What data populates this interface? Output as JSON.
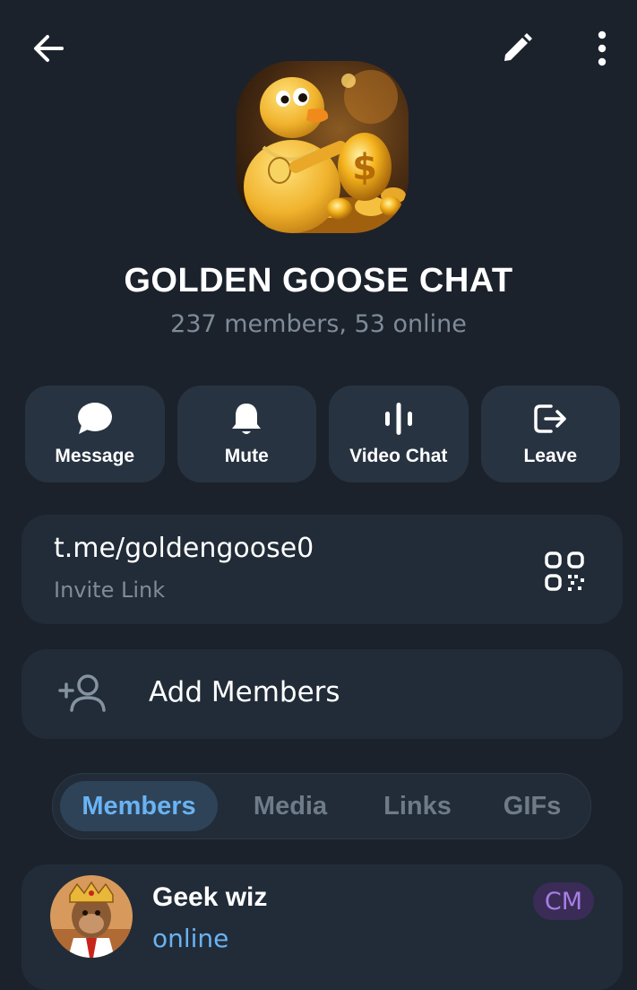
{
  "header": {
    "back_icon": "arrow-left-icon",
    "edit_icon": "pencil-icon",
    "more_icon": "more-vertical-icon"
  },
  "chat": {
    "title": "GOLDEN GOOSE CHAT",
    "subtitle": "237 members, 53 online"
  },
  "actions": [
    {
      "label": "Message",
      "icon": "message-icon"
    },
    {
      "label": "Mute",
      "icon": "bell-icon"
    },
    {
      "label": "Video Chat",
      "icon": "voice-chat-icon"
    },
    {
      "label": "Leave",
      "icon": "leave-icon"
    }
  ],
  "invite": {
    "link": "t.me/goldengoose0",
    "label": "Invite Link",
    "icon": "qr-code-icon"
  },
  "add_members": {
    "label": "Add Members",
    "icon": "add-user-icon"
  },
  "tabs": [
    {
      "label": "Members",
      "active": true
    },
    {
      "label": "Media",
      "active": false
    },
    {
      "label": "Links",
      "active": false
    },
    {
      "label": "GIFs",
      "active": false
    }
  ],
  "members": [
    {
      "name": "Geek wiz",
      "status": "online",
      "badge": "CM"
    }
  ],
  "colors": {
    "background": "#1b222c",
    "card": "#212c38",
    "accent": "#6ab3f3",
    "badge": "#a77ee5"
  }
}
